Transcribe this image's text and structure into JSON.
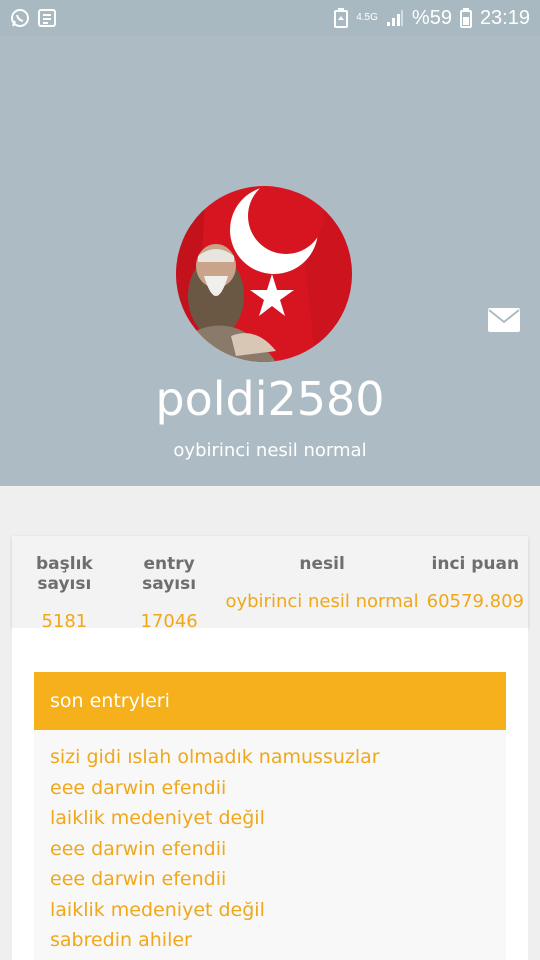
{
  "status_bar": {
    "network": "4.5G",
    "battery": "%59",
    "time": "23:19"
  },
  "profile": {
    "username": "poldi2580",
    "subtitle": "oybirinci nesil normal"
  },
  "stats": [
    {
      "label": "başlık sayısı",
      "value": "5181"
    },
    {
      "label": "entry sayısı",
      "value": "17046"
    },
    {
      "label": "nesil",
      "value": "oybirinci nesil normal"
    },
    {
      "label": "inci puan",
      "value": "60579.809"
    }
  ],
  "recent": {
    "title": "son entryleri",
    "items": [
      "sizi gidi ıslah olmadık namussuzlar",
      "eee darwin efendii",
      "laiklik medeniyet değil",
      "eee darwin efendii",
      "eee darwin efendii",
      "laiklik medeniyet değil",
      "sabredin ahiler"
    ]
  },
  "colors": {
    "header_bg": "#adbcc4",
    "accent": "#f5b01b",
    "link": "#f0a71a"
  }
}
